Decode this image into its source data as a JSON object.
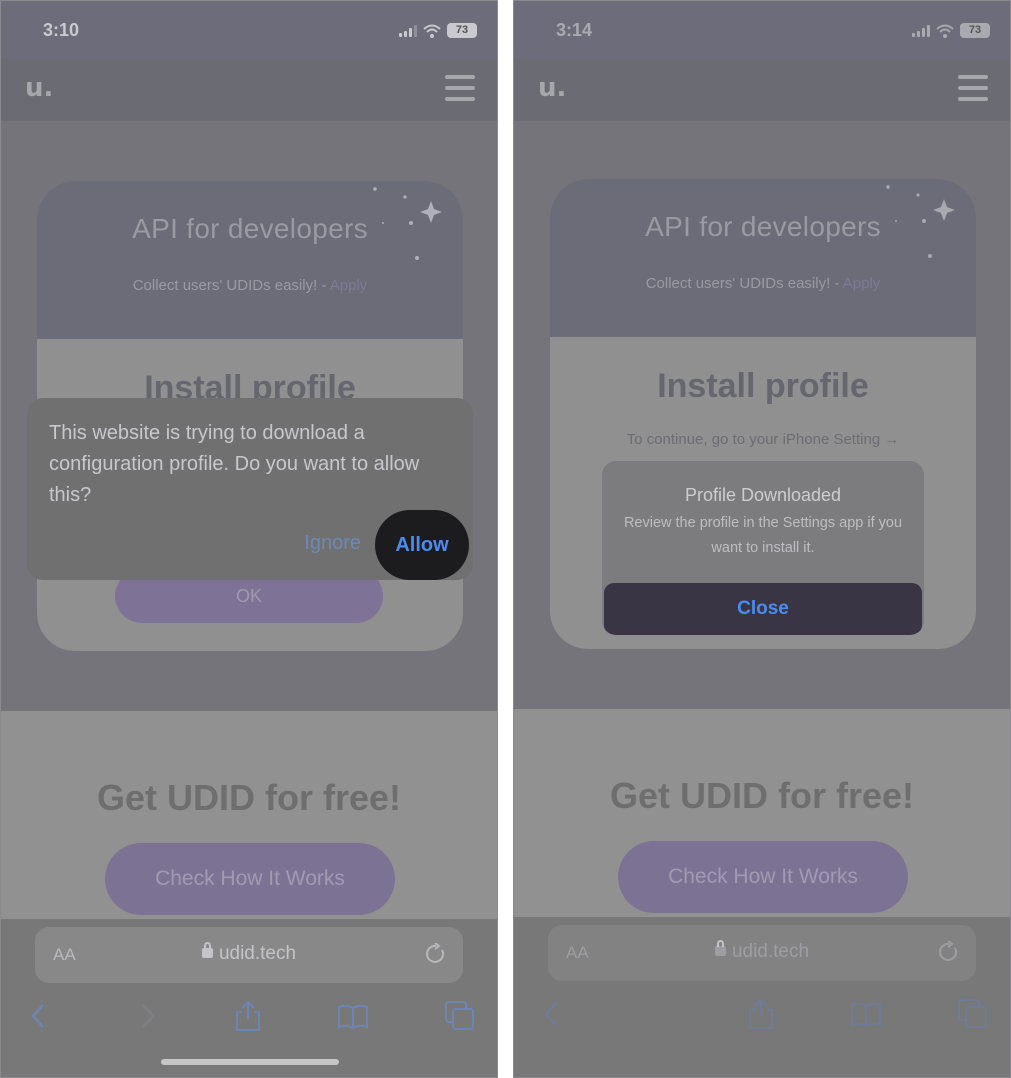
{
  "left": {
    "status": {
      "time": "3:10",
      "battery": "73"
    },
    "site": {
      "logo": "u."
    },
    "card": {
      "title": "API for developers",
      "subtitle": "Collect users' UDIDs easily! - ",
      "apply_link": "Apply",
      "install_title": "Install profile",
      "ok_label": "OK"
    },
    "lower": {
      "title": "Get UDID for free!",
      "cta_label": "Check How It Works"
    },
    "alert": {
      "message": "This website is trying to download a configuration profile. Do you want to allow this?",
      "ignore_label": "Ignore",
      "allow_label": "Allow"
    },
    "browser": {
      "text_size_label": "AA",
      "url": "udid.tech"
    }
  },
  "right": {
    "status": {
      "time": "3:14",
      "battery": "73"
    },
    "site": {
      "logo": "u."
    },
    "card": {
      "title": "API for developers",
      "subtitle": "Collect users' UDIDs easily! - ",
      "apply_link": "Apply",
      "install_title": "Install profile",
      "hint": "To continue, go to your iPhone Setting →"
    },
    "lower": {
      "title": "Get UDID for free!",
      "cta_label": "Check How It Works"
    },
    "alert": {
      "title": "Profile Downloaded",
      "message": "Review the profile in the Settings app if you want to install it.",
      "close_label": "Close"
    },
    "browser": {
      "text_size_label": "AA",
      "url": "udid.tech"
    }
  },
  "colors": {
    "ios_blue": "#4a8cf0",
    "brand_purple": "#7c7294",
    "dim_overlay": "#747379"
  }
}
